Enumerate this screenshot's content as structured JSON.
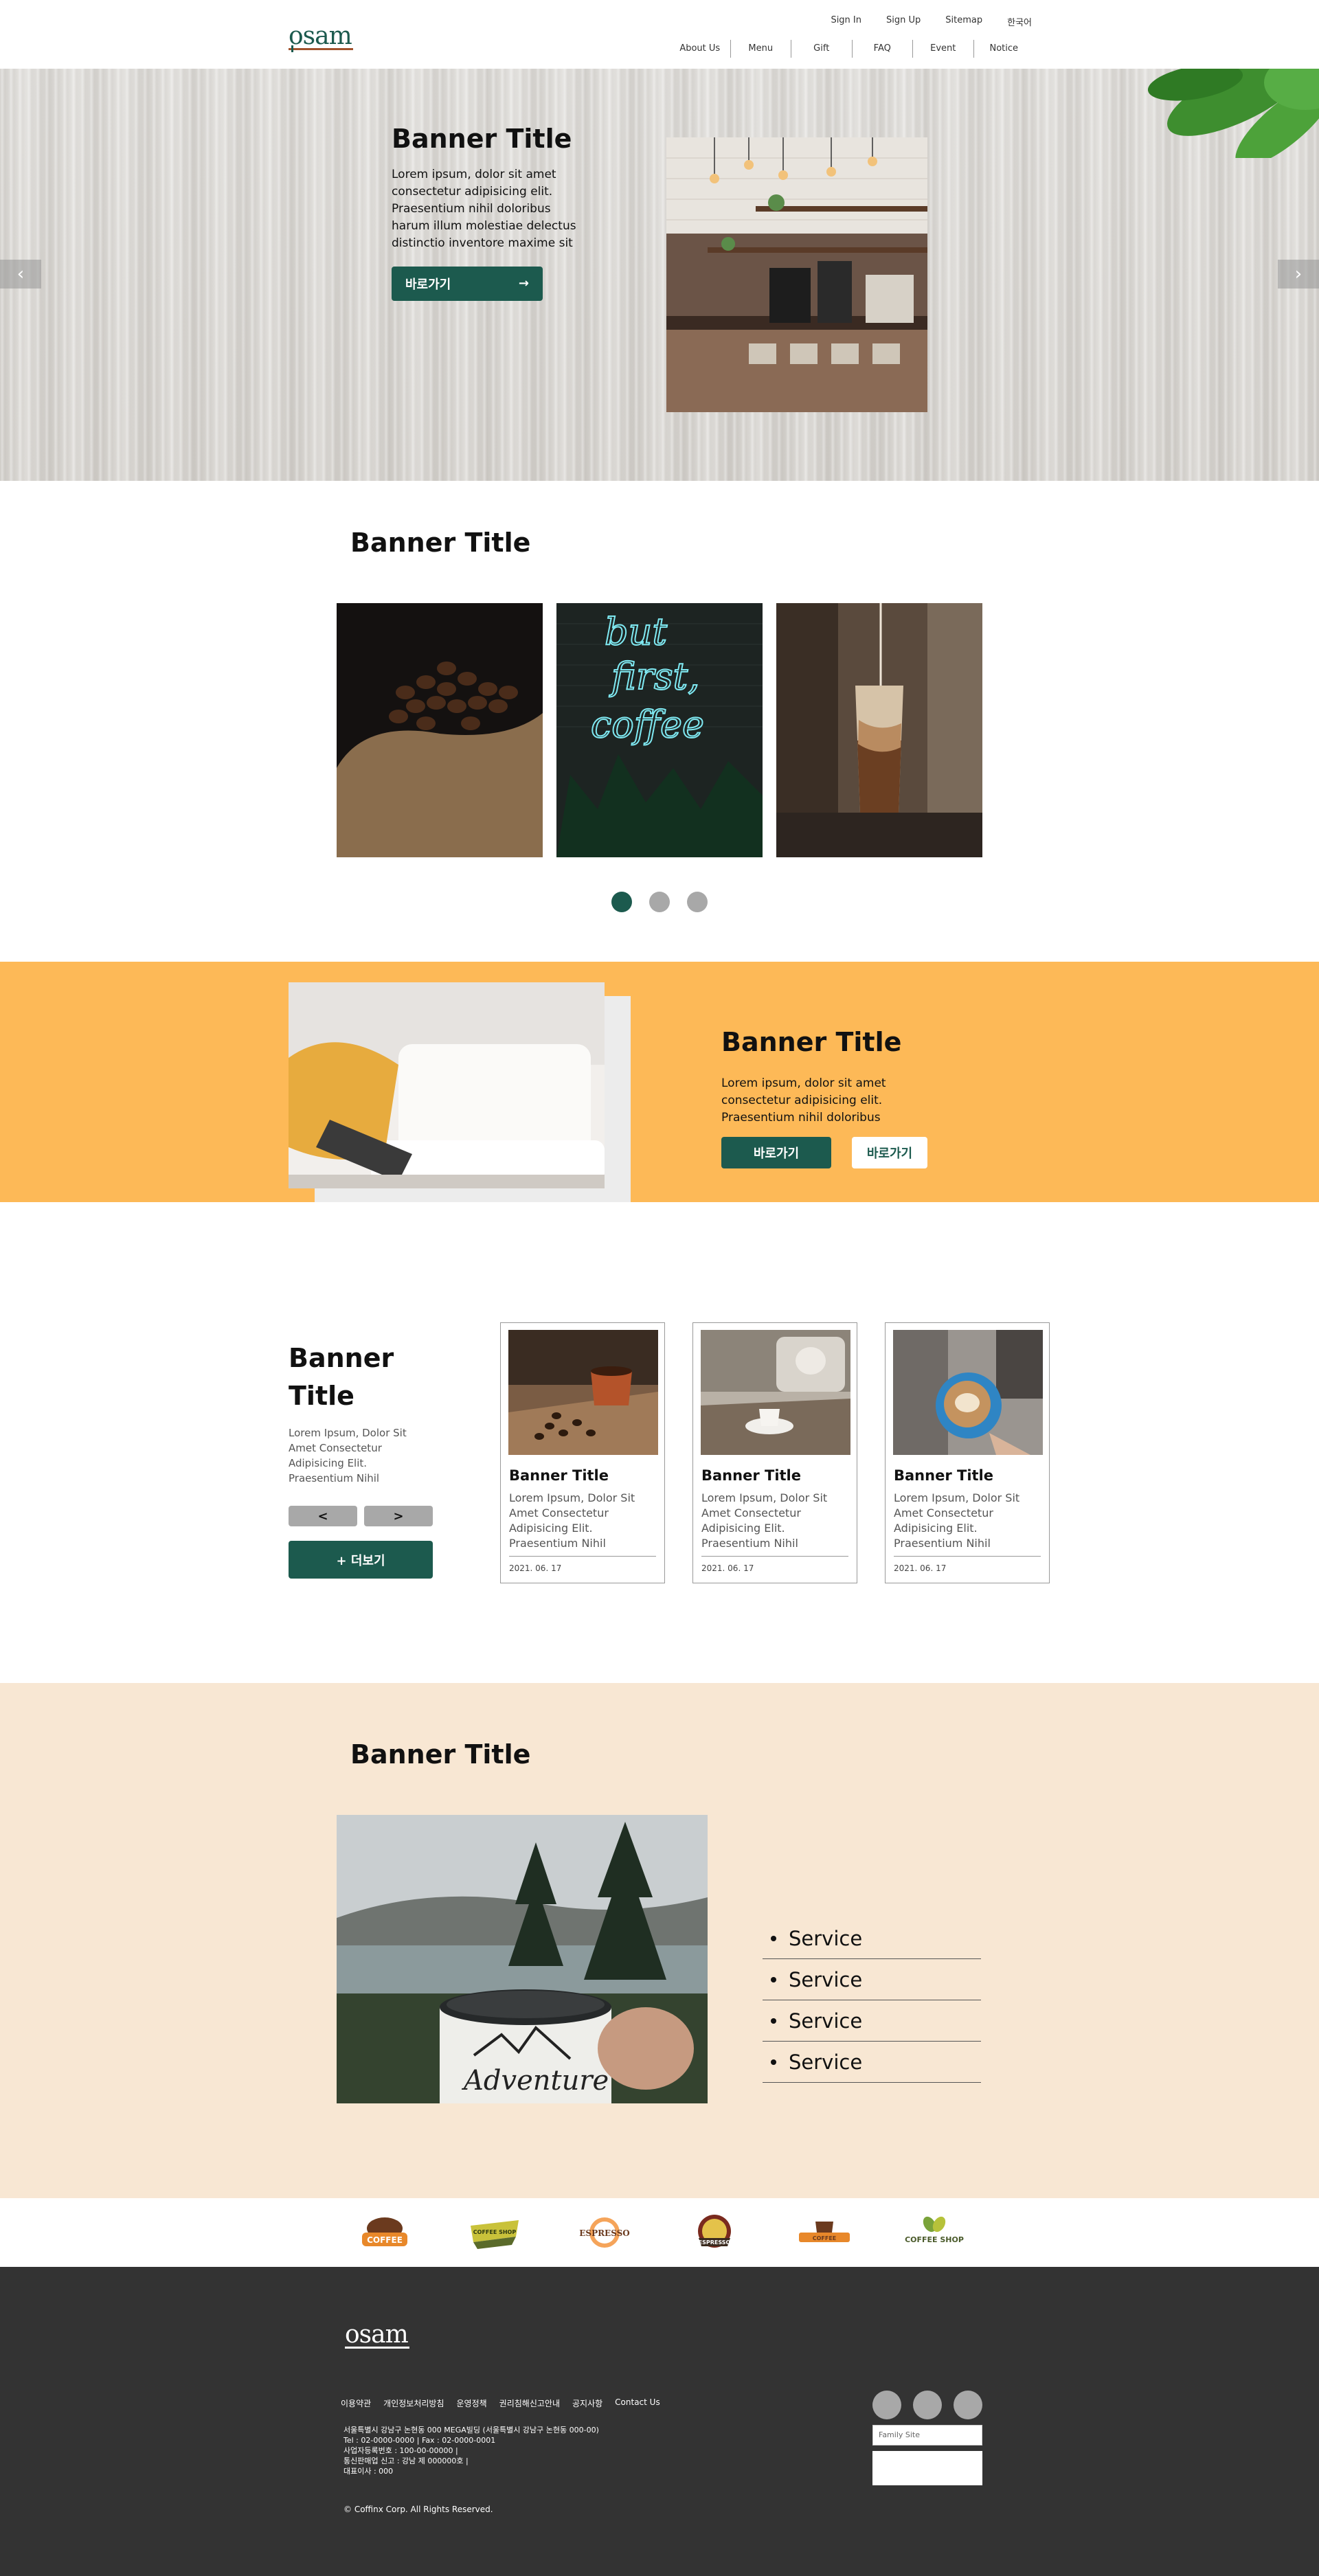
{
  "header": {
    "top_links": [
      "Sign In",
      "Sign Up",
      "Sitemap",
      "한국어"
    ],
    "nav": [
      "About Us",
      "Menu",
      "Gift",
      "FAQ",
      "Event",
      "Notice"
    ],
    "logo_text": "osam"
  },
  "hero": {
    "title": "Banner Title",
    "text": "Lorem ipsum, dolor sit amet consectetur adipisicing elit. Praesentium nihil doloribus harum illum molestiae delectus distinctio inventore maxime sit",
    "button_label": "바로가기",
    "button_arrow": "→",
    "prev_arrow": "‹",
    "next_arrow": "›"
  },
  "gallery": {
    "title": "Banner Title",
    "slide_count": 3,
    "active_slide": 1
  },
  "feature": {
    "title": "Banner Title",
    "text": "Lorem ipsum, dolor sit amet consectetur adipisicing elit. Praesentium nihil doloribus",
    "button1_label": "바로가기",
    "button2_label": "바로가기"
  },
  "news": {
    "title": "Banner Title",
    "text": "Lorem Ipsum, Dolor Sit Amet Consectetur Adipisicing Elit. Praesentium Nihil",
    "prev_label": "<",
    "next_label": ">",
    "more_label": "+ 더보기",
    "cards": [
      {
        "title": "Banner Title",
        "text": "Lorem Ipsum, Dolor Sit Amet Consectetur Adipisicing Elit. Praesentium Nihil",
        "date": "2021. 06. 17"
      },
      {
        "title": "Banner Title",
        "text": "Lorem Ipsum, Dolor Sit Amet Consectetur Adipisicing Elit. Praesentium Nihil",
        "date": "2021. 06. 17"
      },
      {
        "title": "Banner Title",
        "text": "Lorem Ipsum, Dolor Sit Amet Consectetur Adipisicing Elit. Praesentium Nihil",
        "date": "2021. 06. 17"
      }
    ]
  },
  "services": {
    "title": "Banner Title",
    "items": [
      "Service",
      "Service",
      "Service",
      "Service"
    ]
  },
  "brands": [
    "COFFEE",
    "COFFEE SHOP",
    "ESPRESSO",
    "ESPRESSO",
    "COFFEE",
    "COFFEE SHOP"
  ],
  "footer": {
    "logo_text": "osam",
    "links": [
      "이용약관",
      "개인정보처리방침",
      "운영정책",
      "권리침해신고안내",
      "공지사항",
      "Contact Us"
    ],
    "info": [
      "서울특별시 강남구 논현동 000 MEGA빌딩 (서울특별시 강남구 논현동 000-00)",
      "Tel : 02-0000-0000  |  Fax : 02-0000-0001",
      "사업자등록번호 : 100-00-00000  |",
      "통신판매업 신고 : 강남 제 000000호  |",
      "대표이사 : 000"
    ],
    "copyright": "© Coffinx Corp. All Rights Reserved.",
    "family_site": "Family Site"
  },
  "colors": {
    "brand_green": "#1c5a4e",
    "accent_yellow": "#fdb957",
    "beige": "#f8e7d3",
    "footer_bg": "#333333"
  }
}
